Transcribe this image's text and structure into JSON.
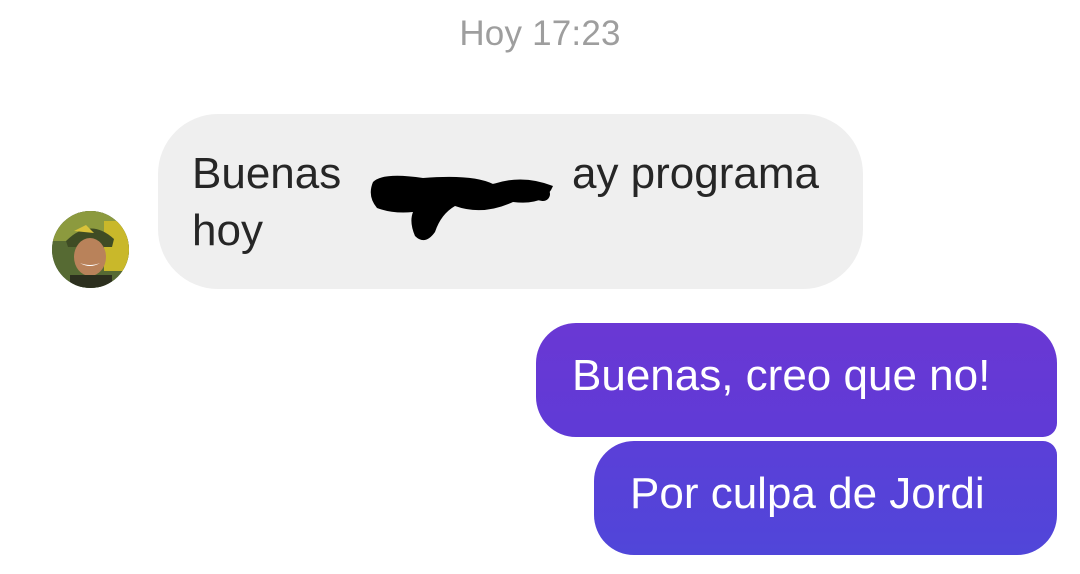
{
  "thread": {
    "timestamp": "Hoy 17:23",
    "incoming": {
      "avatar_icon": "user-avatar-photo",
      "text_before_redaction": "Buenas",
      "text_after_redaction": "ay programa",
      "text_line2": "hoy",
      "bubble_color": "#efefef"
    },
    "outgoing": [
      {
        "text": "Buenas, creo que no!"
      },
      {
        "text": "Por culpa de Jordi"
      }
    ],
    "accent_color": "#6a38d4"
  }
}
